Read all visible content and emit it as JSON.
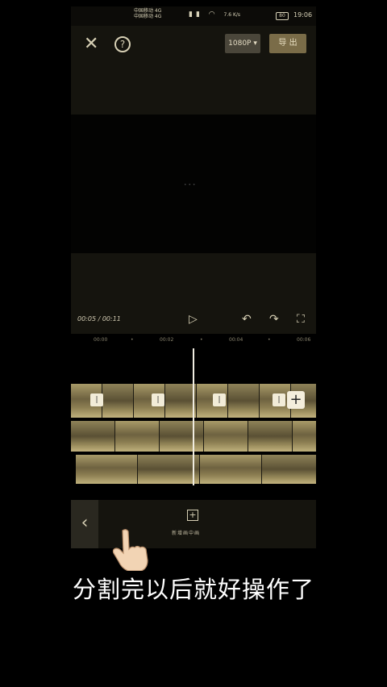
{
  "status_bar": {
    "carrier_top": "中国移动 4G",
    "carrier_bottom": "中国移动 4G",
    "net_speed": "7.6 K/s",
    "battery": "80",
    "time": "19:06"
  },
  "toolbar": {
    "close_icon": "close-icon",
    "help_icon": "help-icon",
    "resolution": "1080P ▾",
    "export_label": "导 出"
  },
  "player": {
    "timecode": "00:05 / 00:11",
    "play_icon": "▷",
    "undo_icon": "↶",
    "redo_icon": "↷",
    "fullscreen_icon": "⛶"
  },
  "ruler": {
    "ticks": [
      "00:00",
      "•",
      "00:02",
      "•",
      "00:04",
      "•",
      "00:06"
    ]
  },
  "timeline": {
    "add_clip_icon": "+",
    "split_marker": "|"
  },
  "bottom_bar": {
    "back_icon": "‹",
    "add_text_icon": "+",
    "add_text_label": "新增画中画"
  },
  "caption": "分割完以后就好操作了",
  "colors": {
    "panel": "#15140e",
    "accent_button": "#7a6c48",
    "caption_text": "#ffffff"
  }
}
